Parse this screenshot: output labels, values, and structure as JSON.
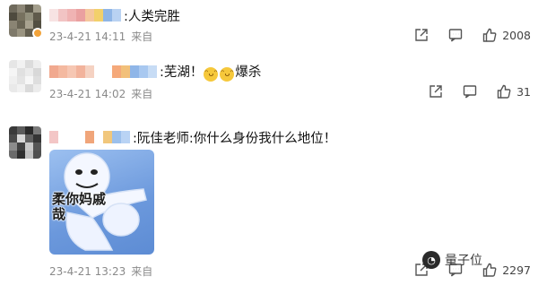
{
  "comments": [
    {
      "text": ":人类完胜",
      "time": "23-4-21 14:11",
      "source": "来自",
      "likes": "2008",
      "avatar_colors": [
        "#6f6a5c",
        "#8c8676",
        "#5a5648",
        "#a39e8c",
        "#4e4a3e",
        "#77715f",
        "#93907d",
        "#5f5a4b",
        "#8a8473",
        "#6a6555",
        "#a8a290",
        "#534f42",
        "#7e796a",
        "#9a9481",
        "#645f50",
        "#878170"
      ],
      "name_colors": [
        "#f7e3e3",
        "#f2c4c4",
        "#f0b3b3",
        "#eaa0a0",
        "#f5c79d",
        "#f2d06b",
        "#8fb5e6",
        "#b9d2f2"
      ],
      "has_badge": true
    },
    {
      "text_before": ":芜湖！",
      "emoji": [
        "haha-emoji",
        "haha-emoji"
      ],
      "text_after": "爆杀",
      "time": "23-4-21 14:02",
      "source": "来自",
      "likes": "31",
      "avatar_colors": [
        "#e6e6e6",
        "#f2f2f2",
        "#dcdcdc",
        "#eeeeee",
        "#f5f5f5",
        "#e0e0e0",
        "#ebebeb",
        "#d8d8d8",
        "#efefef",
        "#e4e4e4",
        "#f7f7f7",
        "#dedede",
        "#e9e9e9",
        "#f1f1f1",
        "#dadada",
        "#ececec"
      ],
      "name_colors": [
        "#f1a98f",
        "#f4b9a0",
        "#f6c7b3",
        "#f2b39c",
        "#f5d2c2",
        "#ffffff",
        "#ffffff",
        "#f5a97a",
        "#f2c07a",
        "#8fb6e8",
        "#a8c8f0",
        "#c7dcf5"
      ],
      "has_badge": false
    },
    {
      "text": ":阮佳老师:你什么身份我什么地位！",
      "time": "23-4-21 13:23",
      "source": "来自",
      "likes": "2297",
      "avatar_colors": [
        "#3a3a3a",
        "#5c5c5c",
        "#2a2a2a",
        "#7a7a7a",
        "#4a4a4a",
        "#d8d8d8",
        "#606060",
        "#353535",
        "#8c8c8c",
        "#424242",
        "#c9c9c9",
        "#555555",
        "#6b6b6b",
        "#2f2f2f",
        "#bfbfbf",
        "#4f4f4f"
      ],
      "name_colors": [
        "#f3c6c6",
        "#ffffff",
        "#ffffff",
        "#ffffff",
        "#f0a57a",
        "#ffffff",
        "#f1c77c",
        "#9cc0ec",
        "#b9d3f4"
      ],
      "sticker_caption": "柔你妈戚哉",
      "has_badge": false
    }
  ],
  "watermark": {
    "text": "量子位",
    "icon": "wechat-icon"
  },
  "icons": {
    "share": "share-icon",
    "comment": "comment-icon",
    "like": "thumbs-up-icon"
  }
}
